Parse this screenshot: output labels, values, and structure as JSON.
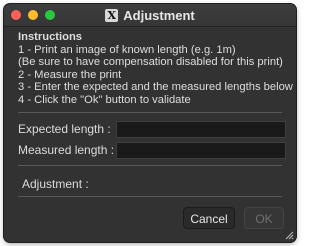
{
  "window": {
    "title": "Adjustment",
    "icon": "x-window-icon",
    "traffic_lights": {
      "close_color": "#fe5f57",
      "minimize_color": "#febc2e",
      "maximize_color": "#28c840"
    }
  },
  "instructions": {
    "heading": "Instructions",
    "lines": [
      "1 - Print an image of known length (e.g. 1m)",
      "(Be sure to have compensation disabled for this print)",
      "2 - Measure the print",
      "3 - Enter the expected and the measured lengths below",
      "4 - Click the \"Ok\" button to validate"
    ]
  },
  "form": {
    "expected_label": "Expected length   :",
    "expected_value": "",
    "measured_label": "Measured length   :",
    "measured_value": ""
  },
  "result": {
    "adjustment_label": "Adjustment  :",
    "adjustment_value": ""
  },
  "buttons": {
    "cancel_label": "Cancel",
    "ok_label": "OK",
    "ok_enabled": false
  }
}
